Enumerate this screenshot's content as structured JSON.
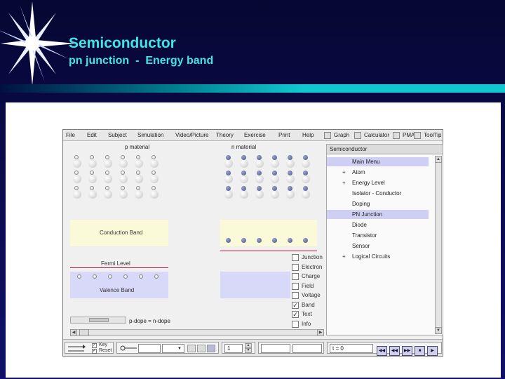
{
  "slide": {
    "title": "Semiconductor",
    "subtitle": "pn junction  -  Energy band"
  },
  "menubar": {
    "items": [
      "File",
      "Edit",
      "Subject",
      "Simulation",
      "Video/Picture",
      "Theory",
      "Exercise",
      "Print",
      "Help"
    ],
    "toggles": [
      "Graph",
      "Calculator",
      "PMA",
      "ToolTip"
    ]
  },
  "panels": {
    "p_label": "p material",
    "n_label": "n material",
    "conduction_band": "Conduction Band",
    "fermi_level": "Fermi Level",
    "valence_band": "Valence Band",
    "scroll_label": "p-dope = n-dope"
  },
  "checklist": [
    {
      "label": "Junction",
      "checked": false
    },
    {
      "label": "Electron",
      "checked": false
    },
    {
      "label": "Charge",
      "checked": false
    },
    {
      "label": "Field",
      "checked": false
    },
    {
      "label": "Voltage",
      "checked": false
    },
    {
      "label": "Band",
      "checked": true
    },
    {
      "label": "Text",
      "checked": true
    },
    {
      "label": "Info",
      "checked": false
    }
  ],
  "tree": {
    "header": "Semiconductor",
    "items": [
      {
        "label": "Main Menu",
        "prefix": "",
        "selected": true
      },
      {
        "label": "Atom",
        "prefix": "+",
        "selected": false
      },
      {
        "label": "Energy Level",
        "prefix": "+",
        "selected": false
      },
      {
        "label": "Isolator - Conductor",
        "prefix": "",
        "selected": false
      },
      {
        "label": "Doping",
        "prefix": "",
        "selected": false
      },
      {
        "label": "PN Junction",
        "prefix": "",
        "selected": true
      },
      {
        "label": "Diode",
        "prefix": "",
        "selected": false
      },
      {
        "label": "Transistor",
        "prefix": "",
        "selected": false
      },
      {
        "label": "Sensor",
        "prefix": "",
        "selected": false
      },
      {
        "label": "Logical Circuits",
        "prefix": "+",
        "selected": false
      }
    ]
  },
  "toolbar": {
    "option_a": "Key",
    "option_b": "Reset",
    "stepper_value": "1",
    "time_readout": "t = 0"
  },
  "colors": {
    "title": "#3fe6e6",
    "conduction_band": "#fafad8",
    "valence_band": "#d8d8f8",
    "fermi_line": "#b02040",
    "tree_selected": "#cfcff4"
  }
}
